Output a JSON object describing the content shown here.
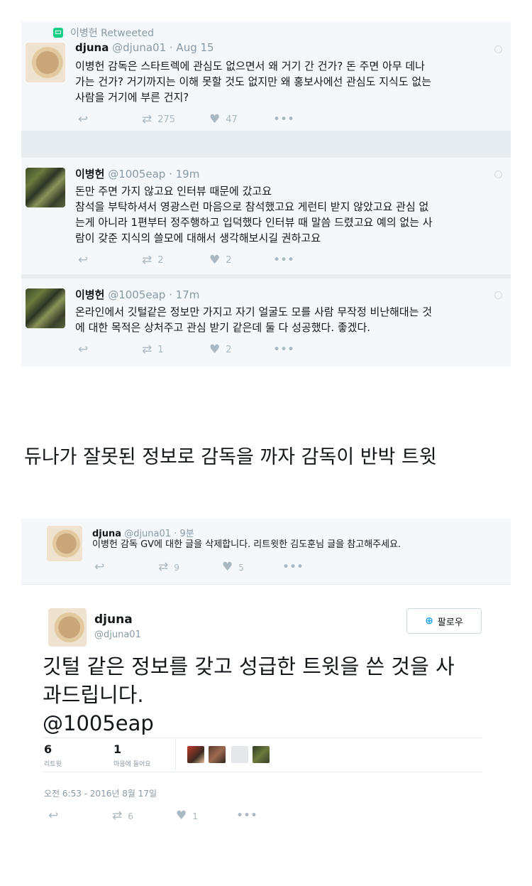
{
  "tweet1": {
    "retweeted_by": "이병헌 Retweeted",
    "name": "djuna",
    "handle_time": "@djuna01 · Aug 15",
    "text_lines": [
      "이병헌 감독은 스타트렉에 관심도 없으면서 왜 거기 간 건가? 돈 주면 아무 데나",
      "가는 건가? 거기까지는 이해 못할 것도 없지만 왜 홍보사에선 관심도 지식도 없는",
      "사람을 거기에 부른 건지?"
    ],
    "retweets": "275",
    "likes": "47"
  },
  "tweet2": {
    "name": "이병헌",
    "handle_time": "@1005eap · 19m",
    "text_lines": [
      "돈만 주면 가지 않고요 인터뷰 때문에 갔고요",
      "참석을 부탁하셔서 영광스런 마음으로 참석했고요 게런티 받지 않았고요 관심 없",
      "는게 아니라 1편부터 정주행하고 입덕했다 인터뷰 때 말씀 드렸고요 예의 없는 사",
      "람이 갖준 지식의 쓸모에 대해서 생각해보시길 권하고요"
    ],
    "retweets": "2",
    "likes": "2"
  },
  "tweet3": {
    "name": "이병헌",
    "handle_time": "@1005eap · 17m",
    "text_lines": [
      "온라인에서 깃털같은 정보만 가지고 자기 얼굴도 모를 사람 무작정 비난해대는 것",
      "에 대한 목적은 상처주고 관심 받기 같은데 둘 다 성공했다. 좋겠다."
    ],
    "retweets": "1",
    "likes": "2"
  },
  "caption": "듀나가 잘못된 정보로 감독을 까자 감독이 반박 트윗",
  "tweet4": {
    "name": "djuna",
    "handle_time": "@djuna01 · 9분",
    "text": "이병헌 감독 GV에 대한 글을 삭제합니다. 리트윗한 김도훈님 글을 참고해주세요.",
    "retweets": "9",
    "likes": "5"
  },
  "tweet5": {
    "name": "djuna",
    "handle": "@djuna01",
    "follow_label": "팔로우",
    "text_lines": [
      "깃털 같은 정보를 갖고 성급한 트윗을 쓴 것을 사",
      "과드립니다."
    ],
    "mention": "@1005eap",
    "retweet_count": "6",
    "retweet_label": "리트윗",
    "like_count": "1",
    "like_label": "마음에 들어요",
    "timestamp": "오전 6:53 - 2016년 8월 17일",
    "retweets": "6",
    "likes": "1"
  },
  "icons": {
    "reply": "reply-icon",
    "retweet": "retweet-icon",
    "like": "heart-icon",
    "more": "more-icon"
  }
}
